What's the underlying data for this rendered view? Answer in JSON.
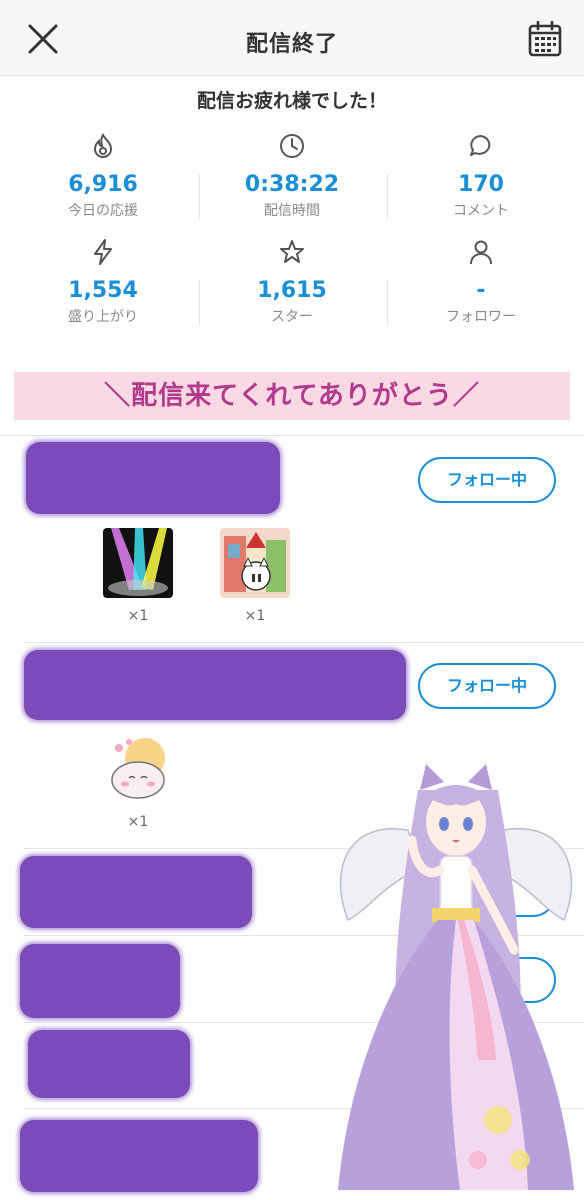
{
  "header": {
    "title": "配信終了",
    "close_icon": "close-icon",
    "calendar_icon": "calendar-icon"
  },
  "subtitle": "配信お疲れ様でした！",
  "stats": [
    {
      "icon": "flame-icon",
      "value": "6,916",
      "label": "今日の応援"
    },
    {
      "icon": "clock-icon",
      "value": "0:38:22",
      "label": "配信時間"
    },
    {
      "icon": "comment-icon",
      "value": "170",
      "label": "コメント"
    },
    {
      "icon": "lightning-icon",
      "value": "1,554",
      "label": "盛り上がり"
    },
    {
      "icon": "star-icon",
      "value": "1,615",
      "label": "スター"
    },
    {
      "icon": "person-icon",
      "value": "-",
      "label": "フォロワー"
    }
  ],
  "banner": "＼配信来てくれてありがとう／",
  "supporters": [
    {
      "follow_label": "フォロー中",
      "gifts": [
        {
          "name": "stage-lights-gift",
          "count": "×1"
        },
        {
          "name": "cat-house-gift",
          "count": "×1"
        }
      ]
    },
    {
      "follow_label": "フォロー中",
      "gifts": [
        {
          "name": "mochi-gift",
          "count": "×1"
        }
      ]
    },
    {
      "follow_label": "",
      "gifts": []
    },
    {
      "follow_label": "",
      "gifts": []
    },
    {
      "follow_label": "",
      "gifts": []
    },
    {
      "follow_label": "",
      "gifts": []
    }
  ],
  "colors": {
    "accent": "#1a8fd6",
    "banner_bg": "#fbd9e3",
    "banner_text": "#b03a8e",
    "redaction": "#7b4bb9"
  }
}
